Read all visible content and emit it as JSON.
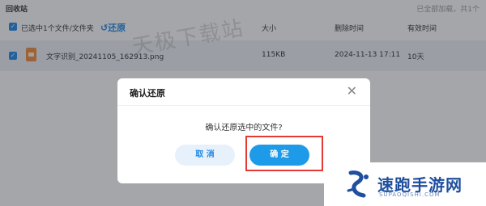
{
  "header": {
    "title": "回收站",
    "loaded_text": "已全部加载，共1个"
  },
  "table": {
    "selection_text": "已选中1个文件/文件夹",
    "restore_label": "还原",
    "columns": [
      "大小",
      "删除时间",
      "有效时间"
    ],
    "rows": [
      {
        "name": "文字识别_20241105_162913.png",
        "size": "115KB",
        "deleted_at": "2024-11-13 17:11",
        "valid_for": "10天"
      }
    ]
  },
  "watermark": "天极下载站",
  "dialog": {
    "title": "确认还原",
    "close_icon": "close-icon",
    "message": "确认还原选中的文件?",
    "cancel_label": "取 消",
    "ok_label": "确 定"
  },
  "brand": {
    "name": "速跑手游网",
    "url": "SUPAOQISHI.COM"
  },
  "colors": {
    "accent": "#1e88e5",
    "primary_button": "#1e9be8",
    "highlight_box": "#e53935",
    "brand": "#1f4f9e"
  }
}
